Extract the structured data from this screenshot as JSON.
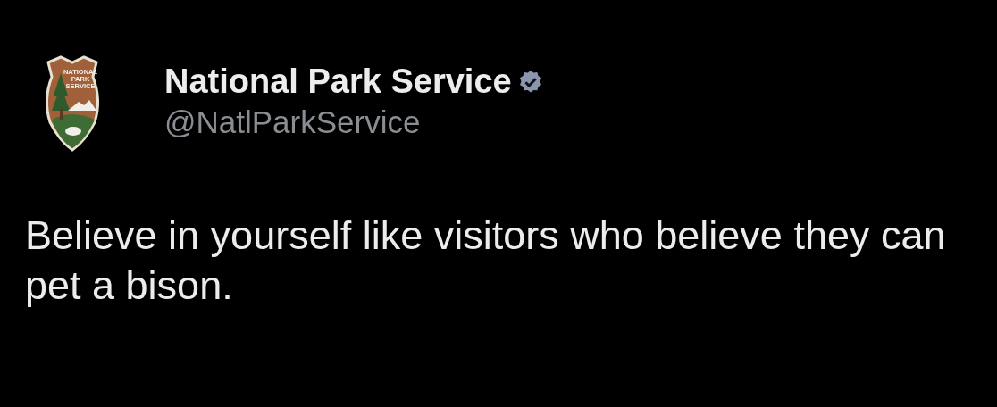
{
  "author": {
    "logo_text": [
      "NATIONAL",
      "PARK",
      "SERVICE"
    ],
    "name": "National Park Service",
    "verified": true,
    "handle": "@NatlParkService"
  },
  "post": {
    "text": "Believe in yourself like visitors who believe they can pet a bison."
  }
}
